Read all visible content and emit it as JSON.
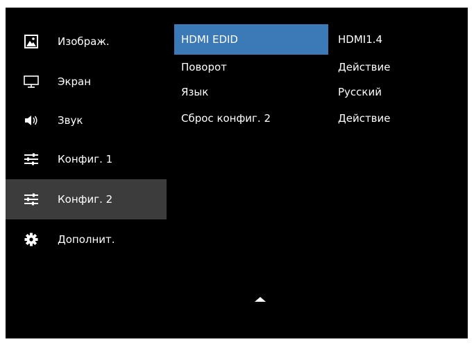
{
  "sidebar": {
    "items": [
      {
        "label": "Изображ.",
        "icon": "picture-icon"
      },
      {
        "label": "Экран",
        "icon": "monitor-icon"
      },
      {
        "label": "Звук",
        "icon": "speaker-icon"
      },
      {
        "label": "Конфиг. 1",
        "icon": "sliders-icon"
      },
      {
        "label": "Конфиг. 2",
        "icon": "sliders-icon",
        "selected": true
      },
      {
        "label": "Дополнит.",
        "icon": "gear-icon"
      }
    ]
  },
  "submenu": {
    "items": [
      {
        "label": "HDMI EDID",
        "value": "HDMI1.4",
        "highlighted": true
      },
      {
        "label": "Поворот",
        "value": "Действие"
      },
      {
        "label": "Язык",
        "value": "Русский"
      },
      {
        "label": "Сброс конфиг. 2",
        "value": "Действие"
      }
    ]
  },
  "navigation": {
    "scroll_up_icon": "up-arrow-icon"
  },
  "colors": {
    "background": "#000000",
    "selected_sidebar": "#3c3c3c",
    "highlight": "#3b79b7",
    "text": "#ffffff"
  }
}
